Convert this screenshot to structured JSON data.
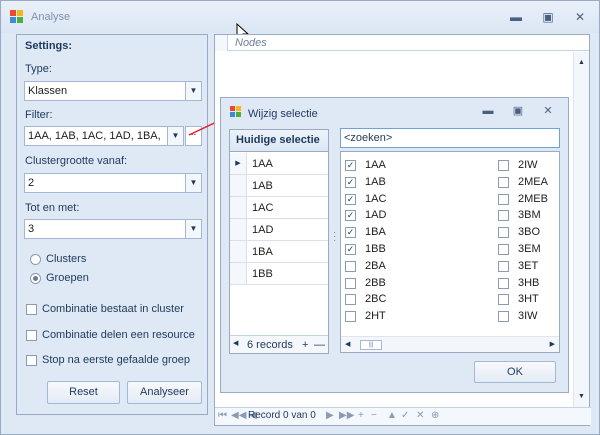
{
  "window": {
    "title": "Analyse",
    "minimize": "▬",
    "maximize": "▣",
    "close": "✕"
  },
  "settings": {
    "heading": "Settings:",
    "type_label": "Type:",
    "type_value": "Klassen",
    "filter_label": "Filter:",
    "filter_value": "1AA,  1AB,  1AC,  1AD,  1BA,",
    "filter_button": "...",
    "cluster_from_label": "Clustergrootte vanaf:",
    "cluster_from_value": "2",
    "until_label": "Tot en met:",
    "until_value": "3",
    "radio_clusters": "Clusters",
    "radio_groepen": "Groepen",
    "selected_radio": "Groepen",
    "check_combinatie_cluster": "Combinatie bestaat in cluster",
    "check_combinatie_resource": "Combinatie delen een resource",
    "check_stop": "Stop na eerste gefaalde groep",
    "reset_button": "Reset",
    "analyse_button": "Analyseer"
  },
  "grid": {
    "column_header": "Nodes",
    "navigator_record": "Record 0 van 0"
  },
  "dialog": {
    "title": "Wijzig selectie",
    "current_header": "Huidige selectie",
    "current_items": [
      "1AA",
      "1AB",
      "1AC",
      "1AD",
      "1BA",
      "1BB"
    ],
    "records_label": "6 records",
    "search_placeholder": "<zoeken>",
    "list_col1": [
      {
        "label": "1AA",
        "checked": true
      },
      {
        "label": "1AB",
        "checked": true
      },
      {
        "label": "1AC",
        "checked": true
      },
      {
        "label": "1AD",
        "checked": true
      },
      {
        "label": "1BA",
        "checked": true
      },
      {
        "label": "1BB",
        "checked": true
      },
      {
        "label": "2BA",
        "checked": false
      },
      {
        "label": "2BB",
        "checked": false
      },
      {
        "label": "2BC",
        "checked": false
      },
      {
        "label": "2HT",
        "checked": false
      }
    ],
    "list_col2": [
      {
        "label": "2IW",
        "checked": false
      },
      {
        "label": "2MEA",
        "checked": false
      },
      {
        "label": "2MEB",
        "checked": false
      },
      {
        "label": "3BM",
        "checked": false
      },
      {
        "label": "3BO",
        "checked": false
      },
      {
        "label": "3EM",
        "checked": false
      },
      {
        "label": "3ET",
        "checked": false
      },
      {
        "label": "3HB",
        "checked": false
      },
      {
        "label": "3HT",
        "checked": false
      },
      {
        "label": "3IW",
        "checked": false
      }
    ],
    "ok_button": "OK"
  },
  "colors": {
    "accent": "#1e395b",
    "arrow": "#e8222b",
    "panel": "#dfe9f5"
  }
}
